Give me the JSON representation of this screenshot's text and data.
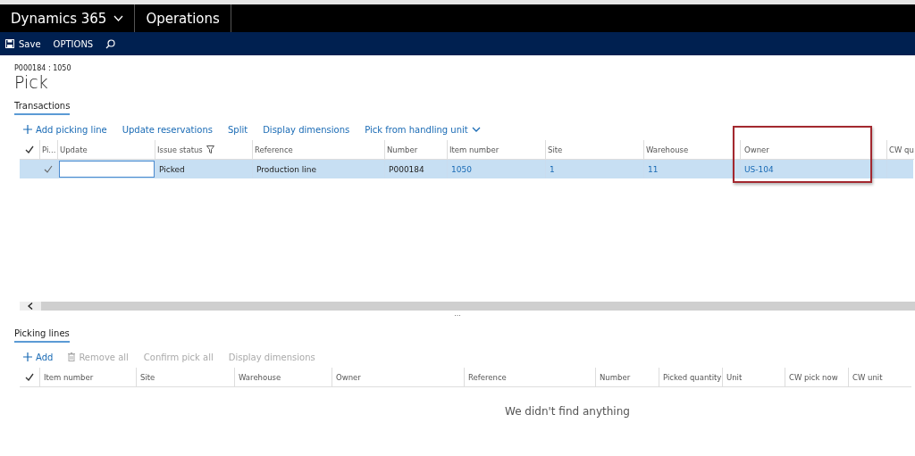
{
  "header": {
    "app_name": "Dynamics 365",
    "module": "Operations"
  },
  "action_bar": {
    "save": "Save",
    "options": "OPTIONS"
  },
  "page": {
    "caption": "P000184 : 1050",
    "title": "Pick"
  },
  "transactions": {
    "tab": "Transactions",
    "actions": [
      {
        "label": "Add picking line",
        "kind": "add",
        "disabled": false
      },
      {
        "label": "Update reservations",
        "kind": "plain",
        "disabled": false
      },
      {
        "label": "Split",
        "kind": "plain",
        "disabled": false
      },
      {
        "label": "Display dimensions",
        "kind": "plain",
        "disabled": false
      },
      {
        "label": "Pick from handling unit",
        "kind": "menu",
        "disabled": false
      }
    ],
    "columns": [
      {
        "label": "Pi...",
        "filtered": false,
        "highlighted": false
      },
      {
        "label": "Update",
        "filtered": false,
        "highlighted": false
      },
      {
        "label": "Issue status",
        "filtered": true,
        "highlighted": false
      },
      {
        "label": "Reference",
        "filtered": false,
        "highlighted": false
      },
      {
        "label": "Number",
        "filtered": false,
        "highlighted": false
      },
      {
        "label": "Item number",
        "filtered": false,
        "highlighted": false
      },
      {
        "label": "Site",
        "filtered": false,
        "highlighted": false
      },
      {
        "label": "Warehouse",
        "filtered": false,
        "highlighted": false
      },
      {
        "label": "Owner",
        "filtered": false,
        "highlighted": true
      },
      {
        "label": "CW qu",
        "filtered": false,
        "highlighted": false
      }
    ],
    "rows": [
      {
        "selected": true,
        "cells": [
          {
            "kind": "check",
            "checked": true
          },
          {
            "kind": "input"
          },
          {
            "kind": "text",
            "text": "Picked",
            "link": false
          },
          {
            "kind": "text",
            "text": "Production line",
            "link": false
          },
          {
            "kind": "text",
            "text": "P000184",
            "link": false
          },
          {
            "kind": "text",
            "text": "1050",
            "link": true
          },
          {
            "kind": "text",
            "text": "1",
            "link": true
          },
          {
            "kind": "text",
            "text": "11",
            "link": true
          },
          {
            "kind": "text",
            "text": "US-104",
            "link": true
          }
        ]
      }
    ],
    "splitter": "..."
  },
  "picking_lines": {
    "tab": "Picking lines",
    "actions": [
      {
        "label": "Add",
        "kind": "add",
        "disabled": false
      },
      {
        "label": "Remove all",
        "kind": "delete",
        "disabled": true
      },
      {
        "label": "Confirm pick all",
        "kind": "plain",
        "disabled": true
      },
      {
        "label": "Display dimensions",
        "kind": "plain",
        "disabled": true
      }
    ],
    "columns": [
      "Item number",
      "Site",
      "Warehouse",
      "Owner",
      "Reference",
      "Number",
      "Picked quantity",
      "Unit",
      "CW pick now",
      "CW unit"
    ],
    "empty_message": "We didn't find anything"
  }
}
